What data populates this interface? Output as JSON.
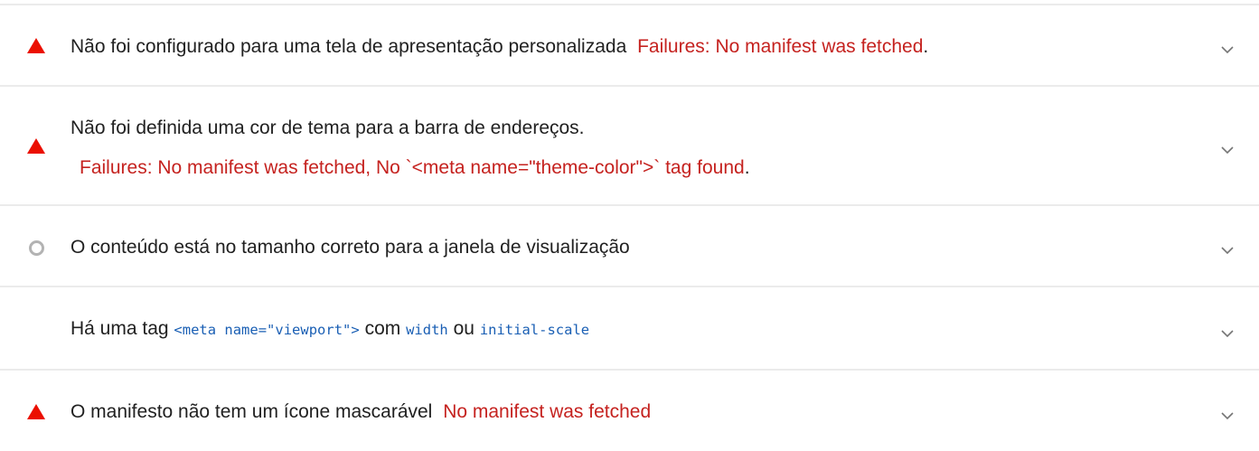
{
  "audits": [
    {
      "status": "fail",
      "title": "Não foi configurado para uma tela de apresentação personalizada",
      "failure": "Failures: No manifest was fetched",
      "failure_end": "."
    },
    {
      "status": "fail",
      "title": "Não foi definida uma cor de tema para a barra de endereços.",
      "failure": "Failures: No manifest was fetched, No `<meta name=\"theme-color\">` tag found",
      "failure_end": "."
    },
    {
      "status": "info",
      "title": "O conteúdo está no tamanho correto para a janela de visualização"
    },
    {
      "status": "pass",
      "title_prefix": "Há uma tag",
      "code1": "<meta name=\"viewport\">",
      "word_with": "com",
      "code2": "width",
      "word_or": "ou",
      "code3": "initial-scale"
    },
    {
      "status": "fail",
      "title": "O manifesto não tem um ícone mascarável",
      "failure": "No manifest was fetched"
    }
  ],
  "colors": {
    "fail": "#eb0f00",
    "fail_text": "#c5221f",
    "info": "#b3b3b3",
    "code": "#1a5fb4",
    "divider": "#ebebeb"
  },
  "icons": {
    "fail": "warning-triangle-icon",
    "info": "circle-outline-icon",
    "expand": "chevron-down-icon"
  }
}
